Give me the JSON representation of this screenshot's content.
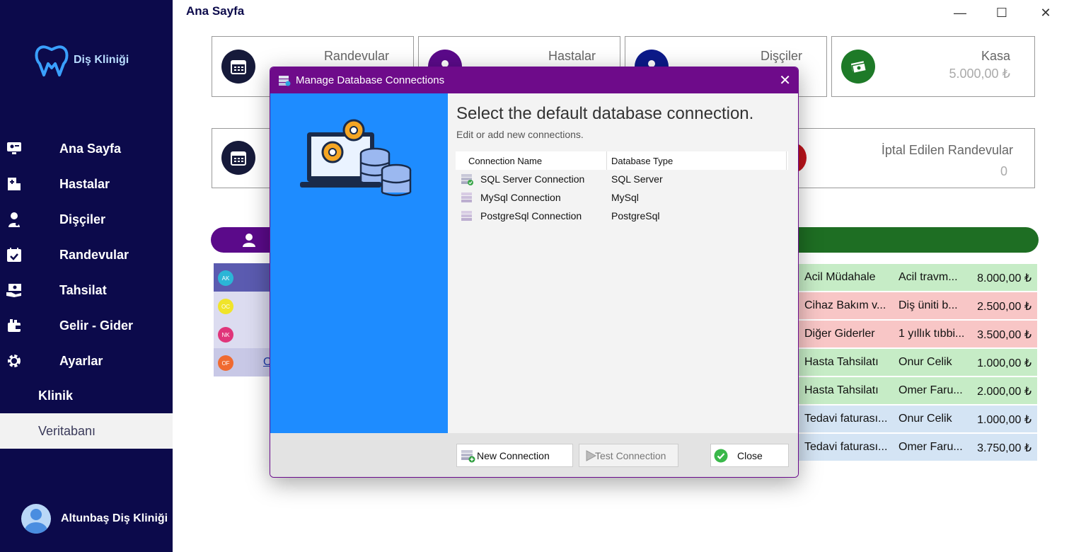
{
  "app": {
    "logo_text": "Diş Kliniği",
    "page_title": "Ana Sayfa",
    "window_controls": {
      "minimize": "—",
      "maximize": "☐",
      "close": "✕"
    }
  },
  "sidebar": {
    "items": [
      {
        "label": "Ana Sayfa",
        "icon": "monitor-icon"
      },
      {
        "label": "Hastalar",
        "icon": "hospital-icon"
      },
      {
        "label": "Dişçiler",
        "icon": "doctor-icon"
      },
      {
        "label": "Randevular",
        "icon": "calendar-check-icon"
      },
      {
        "label": "Tahsilat",
        "icon": "payment-icon"
      },
      {
        "label": "Gelir - Gider",
        "icon": "wallet-icon"
      },
      {
        "label": "Ayarlar",
        "icon": "gear-icon"
      }
    ],
    "sub_items": [
      {
        "label": "Klinik",
        "active": false
      },
      {
        "label": "Veritabanı",
        "active": true
      }
    ],
    "profile_name": "Altunbaş Diş Kliniği"
  },
  "cards": {
    "randevular": {
      "title": "Randevular"
    },
    "hastalar": {
      "title": "Hastalar"
    },
    "disciler": {
      "title": "Dişçiler"
    },
    "kasa": {
      "title": "Kasa",
      "value": "5.000,00 ₺"
    },
    "iptal": {
      "title": "İptal Edilen Randevular",
      "value": "0"
    }
  },
  "colors": {
    "sidebar": "#0c0a4b",
    "purple": "#5b0a8a",
    "green": "#1e6e23",
    "dialog_title": "#6e0b8a",
    "dialog_panel": "#1e8cff"
  },
  "patients": [
    {
      "initials": "AK",
      "color": "#2bb5d6"
    },
    {
      "initials": "OC",
      "color": "#f0e42a"
    },
    {
      "initials": "NK",
      "color": "#e0357a"
    },
    {
      "initials": "OF",
      "color": "#f06a30"
    }
  ],
  "patient_link_partial": "O",
  "transactions": [
    {
      "category": "Acil Müdahale",
      "description": "Acil travm...",
      "amount": "8.000,00 ₺",
      "bg": "#c6ecc6"
    },
    {
      "category": "Cihaz Bakım v...",
      "description": "Diş üniti b...",
      "amount": "2.500,00 ₺",
      "bg": "#f8c6c6"
    },
    {
      "category": "Diğer Giderler",
      "description": "1 yıllık tıbbi...",
      "amount": "3.500,00 ₺",
      "bg": "#f8c6c6"
    },
    {
      "category": "Hasta Tahsilatı",
      "description": "Onur Celik",
      "amount": "1.000,00 ₺",
      "bg": "#c6ecc6"
    },
    {
      "category": "Hasta Tahsilatı",
      "description": "Omer Faru...",
      "amount": "2.000,00 ₺",
      "bg": "#c6ecc6"
    },
    {
      "category": "Tedavi faturası...",
      "description": "Onur Celik",
      "amount": "1.000,00 ₺",
      "bg": "#d4e4f4"
    },
    {
      "category": "Tedavi faturası...",
      "description": "Omer Faru...",
      "amount": "3.750,00 ₺",
      "bg": "#d4e4f4"
    }
  ],
  "dialog": {
    "title": "Manage Database Connections",
    "heading": "Select the default database connection.",
    "subheading": "Edit or add new connections.",
    "columns": {
      "name": "Connection Name",
      "type": "Database Type"
    },
    "connections": [
      {
        "name": "SQL Server Connection",
        "type": "SQL Server",
        "default": true
      },
      {
        "name": "MySql Connection",
        "type": "MySql",
        "default": false
      },
      {
        "name": "PostgreSql Connection",
        "type": "PostgreSql",
        "default": false
      }
    ],
    "buttons": {
      "new": "New Connection",
      "test": "Test Connection",
      "close": "Close"
    },
    "close_glyph": "✕"
  }
}
